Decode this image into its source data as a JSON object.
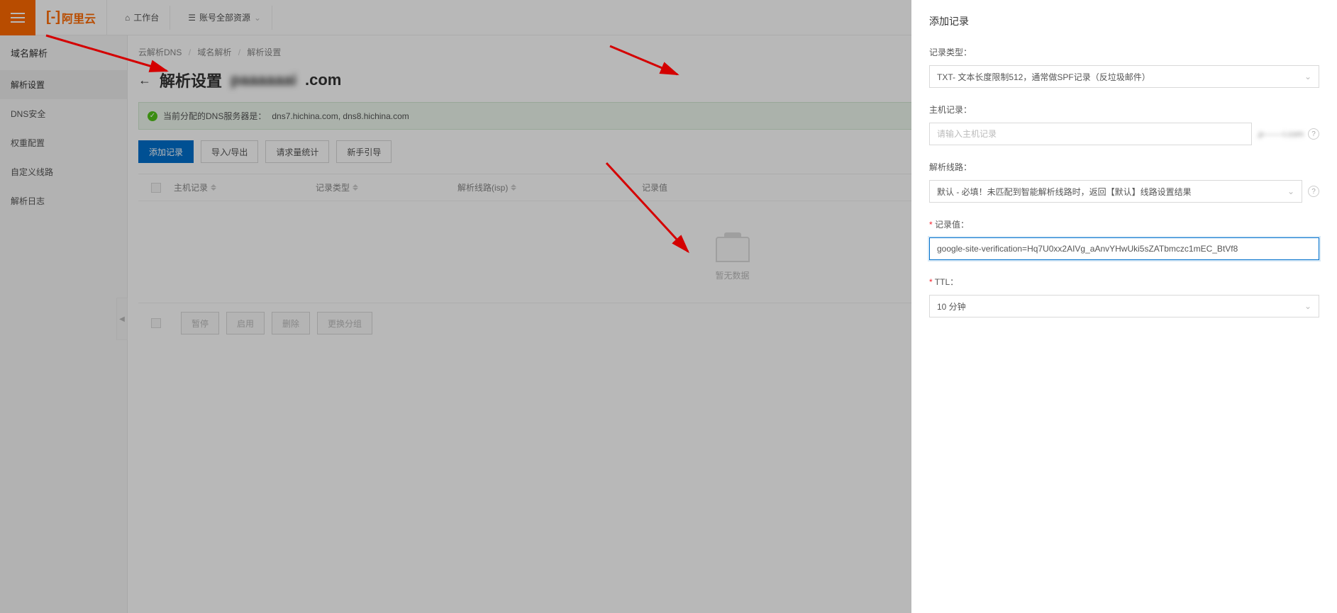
{
  "header": {
    "logo_text": "阿里云",
    "workbench": "工作台",
    "account_resources": "账号全部资源"
  },
  "sidebar": {
    "title": "域名解析",
    "items": [
      {
        "label": "解析设置"
      },
      {
        "label": "DNS安全"
      },
      {
        "label": "权重配置"
      },
      {
        "label": "自定义线路"
      },
      {
        "label": "解析日志"
      }
    ]
  },
  "breadcrumb": {
    "a": "云解析DNS",
    "b": "域名解析",
    "c": "解析设置"
  },
  "page": {
    "title": "解析设置",
    "domain_suffix": ".com",
    "dns_notice_prefix": "当前分配的DNS服务器是：",
    "dns_servers": "dns7.hichina.com, dns8.hichina.com"
  },
  "toolbar": {
    "add": "添加记录",
    "import_export": "导入/导出",
    "request_stats": "请求量统计",
    "guide": "新手引导"
  },
  "table": {
    "col_host": "主机记录",
    "col_type": "记录类型",
    "col_line": "解析线路(isp)",
    "col_value": "记录值",
    "empty": "暂无数据"
  },
  "footer": {
    "pause": "暂停",
    "enable": "启用",
    "delete": "删除",
    "group": "更换分组"
  },
  "drawer": {
    "title": "添加记录",
    "fields": {
      "record_type": {
        "label": "记录类型：",
        "value": "TXT- 文本长度限制512，通常做SPF记录（反垃圾邮件）"
      },
      "host": {
        "label": "主机记录：",
        "placeholder": "请输入主机记录",
        "suffix": ".p-------i.com"
      },
      "line": {
        "label": "解析线路：",
        "value": "默认 - 必填！未匹配到智能解析线路时，返回【默认】线路设置结果"
      },
      "value": {
        "label": "记录值：",
        "value": "google-site-verification=Hq7U0xx2AIVg_aAnvYHwUki5sZATbmczc1mEC_BtVf8"
      },
      "ttl": {
        "label": "TTL：",
        "value": "10 分钟"
      }
    }
  }
}
